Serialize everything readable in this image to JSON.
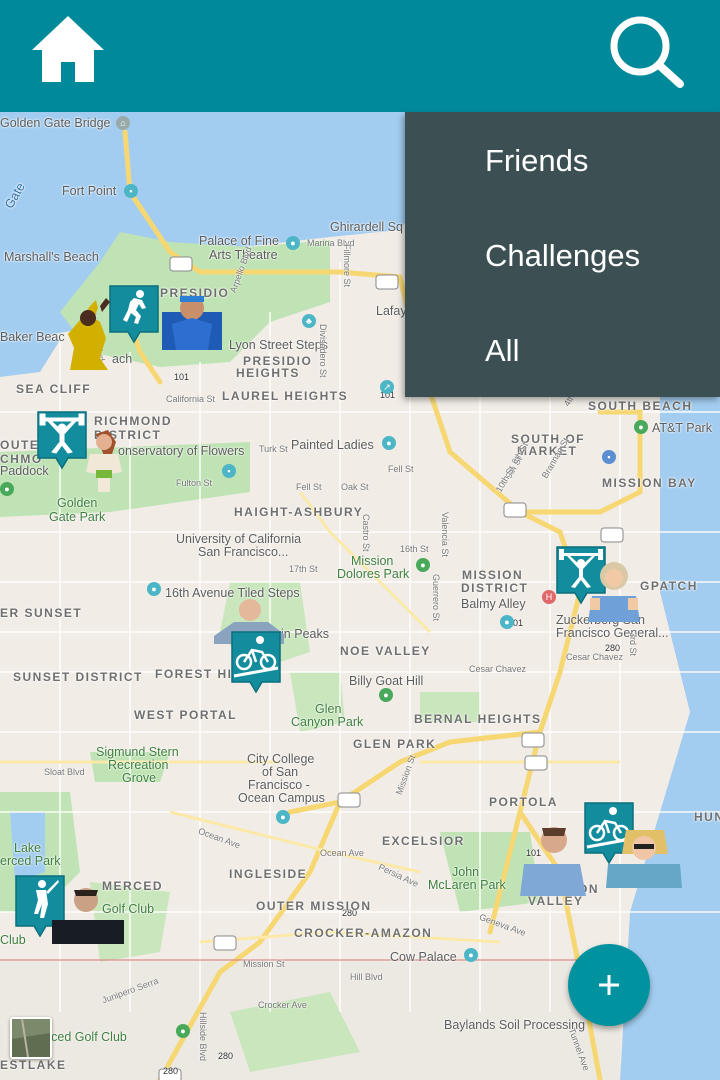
{
  "appbar": {
    "color": "#00899a",
    "home_icon": "home-icon",
    "search_icon": "search-icon"
  },
  "menu": {
    "items": [
      "Friends",
      "Challenges",
      "All"
    ]
  },
  "fab": {
    "icon": "plus-icon",
    "color": "#00939f"
  },
  "map": {
    "labels": {
      "golden_gate_bridge": "Golden Gate Bridge",
      "fort_point": "Fort Point",
      "gate": "Gate",
      "marshalls_beach": "Marshall's Beach",
      "palace": "Palace of Fine",
      "palace2": "Arts Theatre",
      "ghirardelli": "Ghirardell Sq",
      "presidio": "PRESIDIO",
      "baker_beach": "Baker Beac",
      "each": "ach",
      "lafay": "Lafay",
      "lyon_steps": "Lyon Street Steps",
      "presidio_heights": "PRESIDIO",
      "presidio_heights2": "HEIGHTS",
      "sea_cliff": "SEA CLIFF",
      "laurel_heights": "LAUREL HEIGHTS",
      "richmond": "RICHMOND",
      "richmond2": "DISTRICT",
      "outer": "OUTE",
      "outer2": "CHMO",
      "paddock": "Paddock",
      "conservatory": "onservatory of Flowers",
      "painted_ladies": "Painted Ladies",
      "golden_gate_park": "Golden",
      "golden_gate_park2": "Gate Park",
      "haight": "HAIGHT-ASHBURY",
      "south_beach": "SOUTH BEACH",
      "att_park": "AT&T Park",
      "south_market": "SOUTH OF",
      "south_market2": "MARKET",
      "mission_bay": "MISSION BAY",
      "ucsf": "University of California",
      "ucsf2": "San Francisco...",
      "mission_dolores": "Mission",
      "mission_dolores2": "Dolores Park",
      "mission_district": "MISSION",
      "mission_district2": "DISTRICT",
      "balmy": "Balmy Alley",
      "dogpatch": "GPATCH",
      "zuckerberg": "Zuckerberg San",
      "zuckerberg2": "Francisco General...",
      "inner_sunset": "ER SUNSET",
      "tiled_steps": "16th Avenue Tiled Steps",
      "twin_peaks": "win Peaks",
      "noe_valley": "NOE VALLEY",
      "sunset_district": "SUNSET DISTRICT",
      "forest_hill": "FOREST HI",
      "billy_goat": "Billy Goat Hill",
      "west_portal": "WEST PORTAL",
      "glen_canyon": "Glen",
      "glen_canyon2": "Canyon Park",
      "bernal": "BERNAL HEIGHTS",
      "glen_park": "GLEN PARK",
      "stern_grove": "Sigmund Stern",
      "stern_grove2": "Recreation",
      "stern_grove3": "Grove",
      "city_college": "City College",
      "city_college2": "of San",
      "city_college3": "Francisco -",
      "city_college4": "Ocean Campus",
      "portola": "PORTOLA",
      "excelsior": "EXCELSIOR",
      "lake_merced": "Lake",
      "lake_merced2": "erced Park",
      "merced": "MERCED",
      "ingleside": "INGLESIDE",
      "john_mclaren": "John",
      "john_mclaren2": "McLaren Park",
      "golf_club": "Golf Club",
      "club": "Club",
      "outer_mission": "OUTER MISSION",
      "valley": "VALLEY",
      "on": "ON",
      "crocker": "CROCKER-AMAZON",
      "cow_palace": "Cow Palace",
      "hun": "HUN",
      "baylands": "Baylands Soil Processing",
      "merced_golf": "erced Golf Club",
      "estlake": "ESTLAKE"
    },
    "road_labels": {
      "marina": "Marina Blvd",
      "fillmore": "Fillmore St",
      "divisadero": "Divisadero St",
      "california": "California St",
      "turk": "Turk St",
      "fulton": "Fulton St",
      "fell": "Fell St",
      "fell2": "Fell St",
      "oak": "Oak St",
      "st17": "17th St",
      "st16": "16th St",
      "castro": "Castro St",
      "valencia": "Valencia St",
      "guerrero": "Guerrero St",
      "cesar": "Cesar Chavez",
      "cesar2": "Cesar Chavez",
      "sloat": "Sloat Blvd",
      "ocean": "Ocean Ave",
      "ocean2": "Ocean Ave",
      "persia": "Persia Ave",
      "mission": "Mission St",
      "mission2": "Mission St",
      "geneva": "Geneva Ave",
      "hill": "Hill Blvd",
      "lyon": "Lyon St",
      "crocker_ave": "Crocker Ave",
      "junipero": "Junipero Serra",
      "hillside": "Hillside Blvd",
      "tunnel": "Tunnel Ave",
      "brannan": "Brannan St",
      "st4": "4th St",
      "st8": "8th St",
      "st9": "9th St",
      "st10": "10th St",
      "raiders": "Arpello Blvd",
      "ivy": "Lincoln Blvd",
      "st2nd": "3rd St"
    },
    "route_shields": [
      "101",
      "101",
      "101",
      "280",
      "280",
      "280",
      "101",
      "280",
      "280"
    ],
    "markers": [
      {
        "activity": "running-icon"
      },
      {
        "activity": "weightlifting-icon"
      },
      {
        "activity": "weightlifting-icon"
      },
      {
        "activity": "cycling-icon"
      },
      {
        "activity": "cycling-icon"
      },
      {
        "activity": "golf-icon"
      }
    ]
  }
}
